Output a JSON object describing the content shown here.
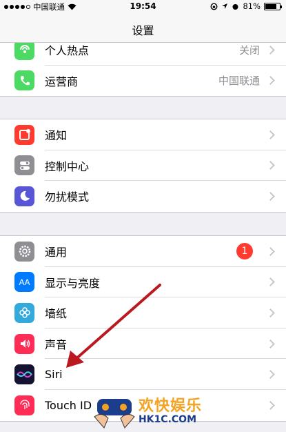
{
  "status_bar": {
    "carrier": "中国联通",
    "time": "19:54",
    "battery": "81%",
    "battery_level": 0.81
  },
  "nav": {
    "title": "设置"
  },
  "group1": [
    {
      "label": "个人热点",
      "value": "关闭",
      "icon": "hotspot-icon",
      "color": "#4cd964"
    },
    {
      "label": "运营商",
      "value": "中国联通",
      "icon": "phone-icon",
      "color": "#4cd964"
    }
  ],
  "group2": [
    {
      "label": "通知",
      "icon": "notification-icon",
      "color": "#ff3b30"
    },
    {
      "label": "控制中心",
      "icon": "control-center-icon",
      "color": "#8e8e93"
    },
    {
      "label": "勿扰模式",
      "icon": "moon-icon",
      "color": "#5856d6"
    }
  ],
  "group3": [
    {
      "label": "通用",
      "icon": "gear-icon",
      "color": "#8e8e93",
      "badge": "1"
    },
    {
      "label": "显示与亮度",
      "icon": "display-icon",
      "color": "#007aff"
    },
    {
      "label": "墙纸",
      "icon": "wallpaper-icon",
      "color": "#34aadc"
    },
    {
      "label": "声音",
      "icon": "sound-icon",
      "color": "#ff2d55"
    },
    {
      "label": "Siri",
      "icon": "siri-icon",
      "color": "#1c1c3c"
    },
    {
      "label": "Touch ID",
      "icon": "fingerprint-icon",
      "color": "#ff2d55"
    }
  ],
  "watermark": {
    "line1": "欢快娱乐",
    "line2": "HK1C.COM"
  }
}
